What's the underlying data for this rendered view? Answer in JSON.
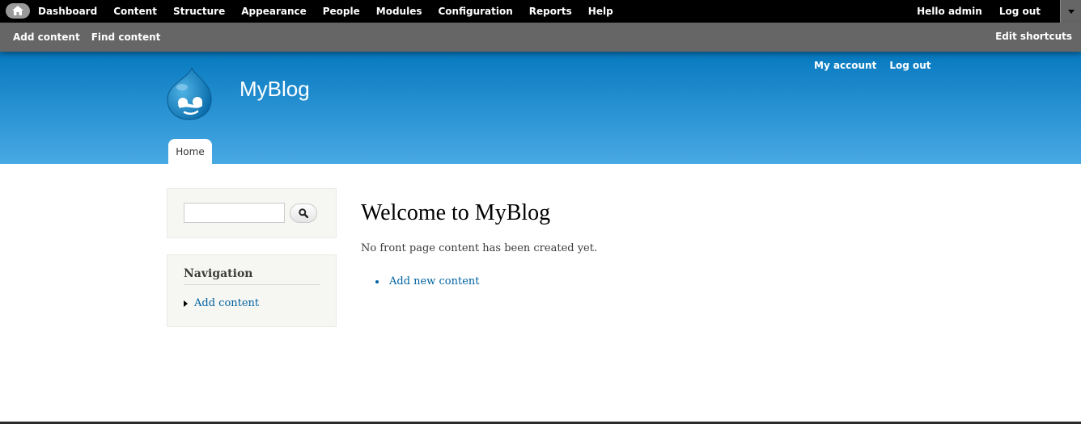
{
  "toolbar": {
    "home_label": "Home",
    "menu": [
      "Dashboard",
      "Content",
      "Structure",
      "Appearance",
      "People",
      "Modules",
      "Configuration",
      "Reports",
      "Help"
    ],
    "hello_prefix": "Hello",
    "username": "admin",
    "logout": "Log out",
    "shortcuts": [
      "Add content",
      "Find content"
    ],
    "edit_shortcuts": "Edit shortcuts"
  },
  "header": {
    "site_name": "MyBlog",
    "secondary_menu": [
      "My account",
      "Log out"
    ],
    "tabs": [
      "Home"
    ]
  },
  "sidebar": {
    "search_value": "",
    "navigation_title": "Navigation",
    "navigation_items": [
      "Add content"
    ]
  },
  "main": {
    "title": "Welcome to MyBlog",
    "message": "No front page content has been created yet.",
    "links": [
      "Add new content"
    ]
  },
  "colors": {
    "toolbar_bg": "#000000",
    "shortcut_bg": "#666666",
    "header_top": "#0779bf",
    "header_bottom": "#48a9e4",
    "link": "#0062a0"
  },
  "icons": [
    "home-icon",
    "drupal-logo-icon",
    "search-icon",
    "chevron-down-icon"
  ]
}
